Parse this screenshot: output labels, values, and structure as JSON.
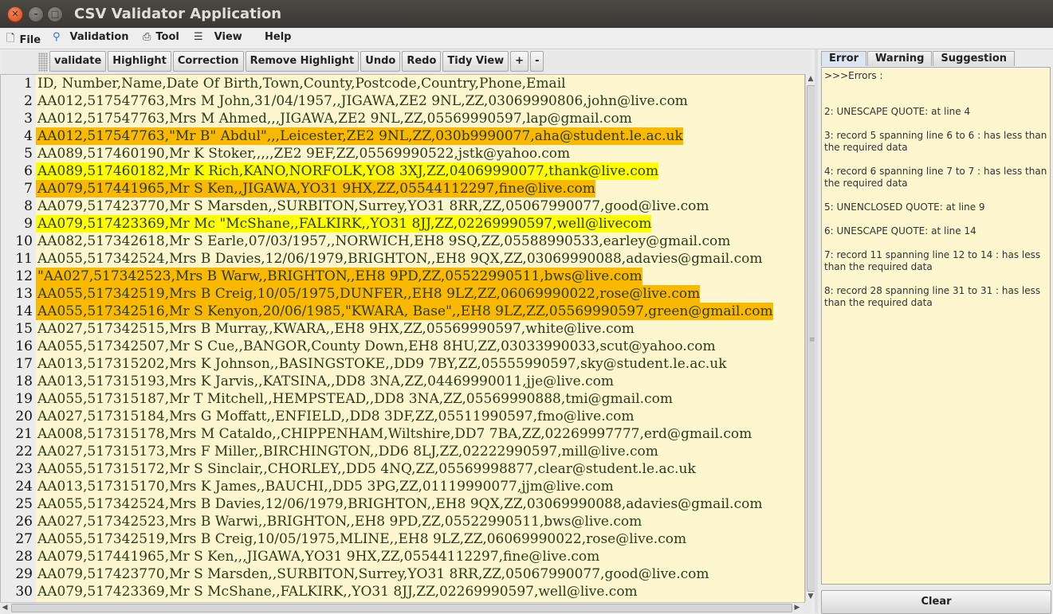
{
  "window": {
    "title": "CSV Validator Application"
  },
  "menu": {
    "file": "File",
    "validation": "Validation",
    "tool": "Tool",
    "view": "View",
    "help": "Help"
  },
  "toolbar": {
    "validate": "validate",
    "highlight": "Highlight",
    "correction": "Correction",
    "remove_highlight": "Remove Highlight",
    "undo": "Undo",
    "redo": "Redo",
    "tidy_view": "Tidy View",
    "plus": "+",
    "minus": "-"
  },
  "editor": {
    "lines": [
      {
        "n": "1",
        "text": "ID, Number,Name,Date Of Birth,Town,County,Postcode,Country,Phone,Email",
        "hl": ""
      },
      {
        "n": "2",
        "text": "AA012,517547763,Mrs M John,31/04/1957,,JIGAWA,ZE2 9NL,ZZ,03069990806,john@live.com",
        "hl": ""
      },
      {
        "n": "3",
        "text": "AA012,517547763,Mrs M Ahmed,,,JIGAWA,ZE2 9NL,ZZ,05569990597,lap@gmail.com",
        "hl": ""
      },
      {
        "n": "4",
        "text": "AA012,517547763,\"Mr B\" Abdul\",,,Leicester,ZE2 9NL,ZZ,030b9990077,aha@student.le.ac.uk",
        "hl": "orange"
      },
      {
        "n": "5",
        "text": "AA089,517460190,Mr K Stoker,,,,,ZE2 9EF,ZZ,05569990522,jstk@yahoo.com",
        "hl": ""
      },
      {
        "n": "6",
        "text": "AA089,517460182,Mr K Rich,KANO,NORFOLK,YO8 3XJ,ZZ,04069990077,thank@live.com",
        "hl": "yellow"
      },
      {
        "n": "7",
        "text": "AA079,517441965,Mr S Ken,,JIGAWA,YO31 9HX,ZZ,05544112297,fine@live.com",
        "hl": "orange"
      },
      {
        "n": "8",
        "text": "AA079,517423770,Mr S Marsden,,SURBITON,Surrey,YO31 8RR,ZZ,05067990077,good@live.com",
        "hl": ""
      },
      {
        "n": "9",
        "text": "AA079,517423369,Mr Mc \"McShane,,FALKIRK,,YO31 8JJ,ZZ,02269990597,well@livecom",
        "hl": "yellow"
      },
      {
        "n": "10",
        "text": "AA082,517342618,Mr S Earle,07/03/1957,,NORWICH,EH8 9SQ,ZZ,05588990533,earley@gmail.com",
        "hl": ""
      },
      {
        "n": "11",
        "text": "AA055,517342524,Mrs B Davies,12/06/1979,BRIGHTON,,EH8 9QX,ZZ,03069990088,adavies@gmail.com",
        "hl": ""
      },
      {
        "n": "12",
        "text": "\"AA027,517342523,Mrs B Warw,,BRIGHTON,,EH8 9PD,ZZ,05522990511,bws@live.com",
        "hl": "orange"
      },
      {
        "n": "13",
        "text": "AA055,517342519,Mrs B Creig,10/05/1975,DUNFER,,EH8 9LZ,ZZ,06069990022,rose@live.com",
        "hl": "orange"
      },
      {
        "n": "14",
        "text": "AA055,517342516,Mr S Kenyon,20/06/1985,\"KWARA, Base\",,EH8 9LZ,ZZ,05569990597,green@gmail.com",
        "hl": "orange"
      },
      {
        "n": "15",
        "text": "AA027,517342515,Mrs B Murray,,KWARA,,EH8 9HX,ZZ,05569990597,white@live.com",
        "hl": ""
      },
      {
        "n": "16",
        "text": "AA055,517342507,Mr S Cue,,BANGOR,County Down,EH8 8HU,ZZ,03033990033,scut@yahoo.com",
        "hl": ""
      },
      {
        "n": "17",
        "text": "AA013,517315202,Mrs K Johnson,,BASINGSTOKE,,DD9 7BY,ZZ,05555990597,sky@student.le.ac.uk",
        "hl": ""
      },
      {
        "n": "18",
        "text": "AA013,517315193,Mrs K Jarvis,,KATSINA,,DD8 3NA,ZZ,04469990011,jje@live.com",
        "hl": ""
      },
      {
        "n": "19",
        "text": "AA055,517315187,Mr T Mitchell,,HEMPSTEAD,,DD8 3NA,ZZ,05569990888,tmi@gmail.com",
        "hl": ""
      },
      {
        "n": "20",
        "text": "AA027,517315184,Mrs G Moffatt,,ENFIELD,,DD8 3DF,ZZ,05511990597,fmo@live.com",
        "hl": ""
      },
      {
        "n": "21",
        "text": "AA008,517315178,Mrs M Cataldo,,CHIPPENHAM,Wiltshire,DD7 7BA,ZZ,02269997777,erd@gmail.com",
        "hl": ""
      },
      {
        "n": "22",
        "text": "AA027,517315173,Mrs F Miller,,BIRCHINGTON,,DD6 8LJ,ZZ,02222990597,mill@live.com",
        "hl": ""
      },
      {
        "n": "23",
        "text": "AA055,517315172,Mr S Sinclair,,CHORLEY,,DD5 4NQ,ZZ,05569998877,clear@student.le.ac.uk",
        "hl": ""
      },
      {
        "n": "24",
        "text": "AA013,517315170,Mrs K James,,BAUCHI,,DD5 3PG,ZZ,01119990077,jjm@live.com",
        "hl": ""
      },
      {
        "n": "25",
        "text": "AA055,517342524,Mrs B Davies,12/06/1979,BRIGHTON,,EH8 9QX,ZZ,03069990088,adavies@gmail.com",
        "hl": ""
      },
      {
        "n": "26",
        "text": "AA027,517342523,Mrs B Warwi,,BRIGHTON,,EH8 9PD,ZZ,05522990511,bws@live.com",
        "hl": ""
      },
      {
        "n": "27",
        "text": "AA055,517342519,Mrs B Creig,10/05/1975,MLINE,,EH8 9LZ,ZZ,06069990022,rose@live.com",
        "hl": ""
      },
      {
        "n": "28",
        "text": "AA079,517441965,Mr S Ken,,,JIGAWA,YO31 9HX,ZZ,05544112297,fine@live.com",
        "hl": ""
      },
      {
        "n": "29",
        "text": "AA079,517423770,Mr S Marsden,,SURBITON,Surrey,YO31 8RR,ZZ,05067990077,good@live.com",
        "hl": ""
      },
      {
        "n": "30",
        "text": "AA079,517423369,Mr S McShane,,FALKIRK,,YO31 8JJ,ZZ,02269990597,well@live.com",
        "hl": ""
      }
    ]
  },
  "tabs": {
    "error": "Error",
    "warning": "Warning",
    "suggestion": "Suggestion"
  },
  "errors": {
    "header": ">>>Errors :",
    "items": [
      "2: UNESCAPE QUOTE:   at line 4",
      "3: record 5 spanning line 6 to 6 : has less than the required data",
      "4: record 6 spanning line 7 to 7 : has less than the required data",
      "5: UNENCLOSED QUOTE: at line 9",
      "6: UNESCAPE QUOTE:   at line 14",
      "7: record 11 spanning line 12 to 14 : has less than the required data",
      "8: record 28 spanning line 31 to 31 : has less than the required data"
    ]
  },
  "clear_button": "Clear",
  "colors": {
    "editor_bg": "#fdf6cf",
    "highlight_orange": "#f8b900",
    "highlight_yellow": "#ffff00"
  }
}
